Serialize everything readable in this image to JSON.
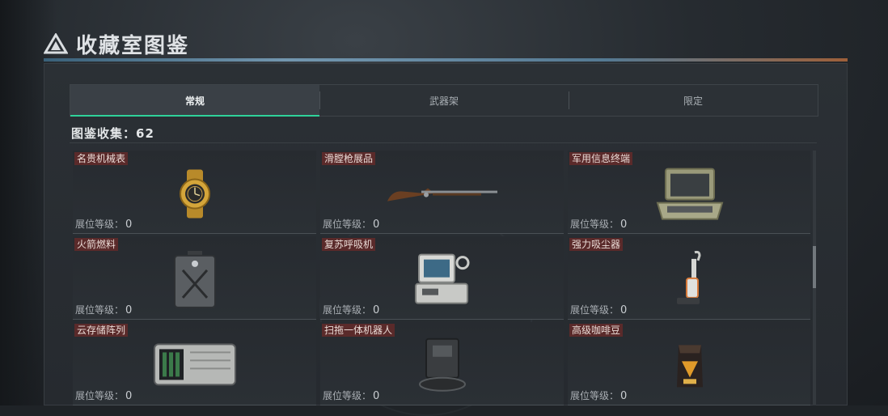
{
  "header": {
    "title": "收藏室图鉴"
  },
  "tabs": [
    {
      "label": "常规",
      "active": true
    },
    {
      "label": "武器架",
      "active": false
    },
    {
      "label": "限定",
      "active": false
    }
  ],
  "collection": {
    "label": "图鉴收集：",
    "count": "62"
  },
  "level_label": "展位等级：",
  "items": [
    {
      "name": "名贵机械表",
      "icon": "gold-watch-icon",
      "level": "0"
    },
    {
      "name": "滑膛枪展品",
      "icon": "musket-icon",
      "level": "0"
    },
    {
      "name": "军用信息终端",
      "icon": "military-terminal-icon",
      "level": "0"
    },
    {
      "name": "火箭燃料",
      "icon": "fuel-can-icon",
      "level": "0"
    },
    {
      "name": "复苏呼吸机",
      "icon": "ventilator-icon",
      "level": "0"
    },
    {
      "name": "强力吸尘器",
      "icon": "vacuum-cleaner-icon",
      "level": "0"
    },
    {
      "name": "云存储阵列",
      "icon": "storage-array-icon",
      "level": "0"
    },
    {
      "name": "扫拖一体机器人",
      "icon": "mop-robot-icon",
      "level": "0"
    },
    {
      "name": "高级咖啡豆",
      "icon": "coffee-bean-bag-icon",
      "level": "0"
    }
  ],
  "colors": {
    "accent": "#2fd29a",
    "name_tag": "#5a2a2a"
  }
}
